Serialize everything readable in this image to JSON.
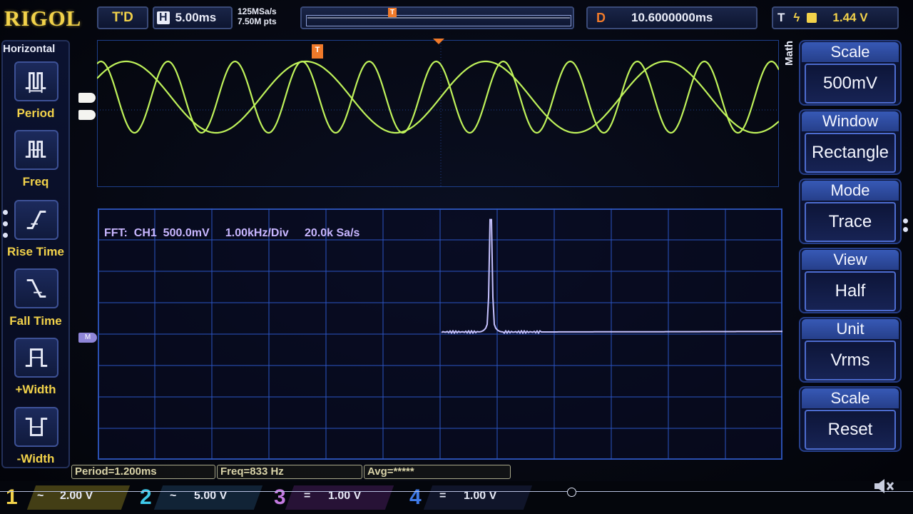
{
  "header": {
    "logo": "RIGOL",
    "trigger_status": "T'D",
    "horizontal_label": "H",
    "timebase": "5.00ms",
    "sample_rate": "125MSa/s",
    "mem_depth": "7.50M pts",
    "delay_label": "D",
    "delay_value": "10.6000000ms",
    "trigger_label": "T",
    "trigger_level": "1.44 V"
  },
  "left_menu": {
    "title": "Horizontal",
    "items": [
      {
        "label": "Period",
        "icon": "period-icon"
      },
      {
        "label": "Freq",
        "icon": "freq-icon"
      },
      {
        "label": "Rise Time",
        "icon": "rise-time-icon"
      },
      {
        "label": "Fall Time",
        "icon": "fall-time-icon"
      },
      {
        "label": "+Width",
        "icon": "plus-width-icon"
      },
      {
        "label": "-Width",
        "icon": "minus-width-icon"
      }
    ]
  },
  "fft": {
    "source": "FFT:  CH1",
    "scale": "500.0mV",
    "hdiv": "1.00kHz/Div",
    "rate": "20.0k Sa/s",
    "marker": "M"
  },
  "right_menu": {
    "side_title": "Math",
    "items": [
      {
        "title": "Scale",
        "value": "500mV"
      },
      {
        "title": "Window",
        "value": "Rectangle"
      },
      {
        "title": "Mode",
        "value": "Trace"
      },
      {
        "title": "View",
        "value": "Half"
      },
      {
        "title": "Unit",
        "value": "Vrms"
      },
      {
        "title": "Scale",
        "value": "Reset"
      }
    ]
  },
  "measurements": {
    "period": "Period=1.200ms",
    "freq": "Freq=833 Hz",
    "avg": "Avg=*****"
  },
  "channels": [
    {
      "num": "1",
      "coupling": "~",
      "scale": "2.00 V",
      "color": "#f2d24a"
    },
    {
      "num": "2",
      "coupling": "~",
      "scale": "5.00 V",
      "color": "#3ec8e8"
    },
    {
      "num": "3",
      "coupling": "=",
      "scale": "1.00 V",
      "color": "#c37ae0"
    },
    {
      "num": "4",
      "coupling": "=",
      "scale": "1.00 V",
      "color": "#3f7ae8"
    }
  ],
  "colors": {
    "trace": "#bff25a",
    "fft_trace": "#c6c2ff",
    "grid": "#2b55c4",
    "accent": "#f2d24a"
  }
}
